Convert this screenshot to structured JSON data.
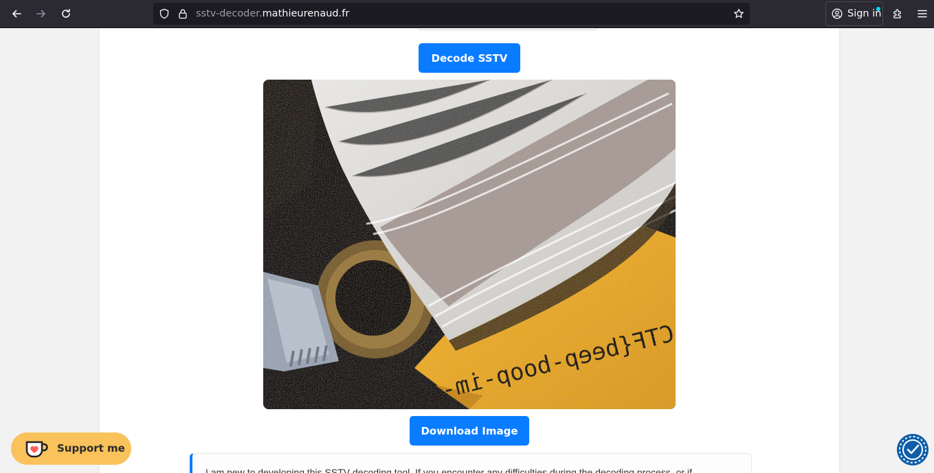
{
  "browser": {
    "url_prefix": "sstv-decoder.",
    "url_domain": "mathieurenaud.fr",
    "signin_label": "Sign in"
  },
  "page": {
    "decode_button": "Decode SSTV",
    "download_button": "Download Image",
    "decoded_image_caption": "CTF{beep-boop-im-in-space}",
    "info_text": "I am new to developing this SSTV decoding tool. If you encounter any difficulties during the decoding process, or if",
    "support_button": "Support me"
  },
  "colors": {
    "accent": "#0a7cff",
    "support_bg": "#f9c25a",
    "toolbar_bg": "#2b2a33",
    "accessibility_bg": "#0e5ea8"
  },
  "icons": [
    "back-arrow-icon",
    "forward-arrow-icon",
    "reload-icon",
    "shield-icon",
    "lock-icon",
    "star-icon",
    "account-icon",
    "extensions-icon",
    "menu-icon",
    "ko-fi-cup-icon",
    "accessibility-icon"
  ]
}
